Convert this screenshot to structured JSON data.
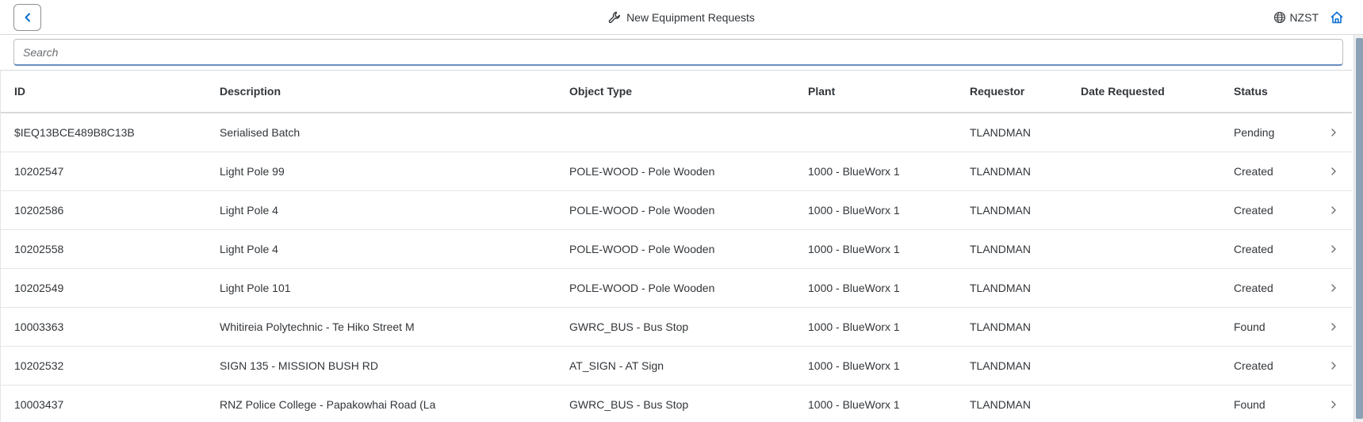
{
  "header": {
    "title": "New Equipment Requests",
    "timezone": "NZST",
    "accent_color": "#0a6ed1"
  },
  "search": {
    "placeholder": "Search",
    "value": ""
  },
  "table": {
    "columns": [
      "ID",
      "Description",
      "Object Type",
      "Plant",
      "Requestor",
      "Date Requested",
      "Status"
    ],
    "rows": [
      {
        "id": "$IEQ13BCE489B8C13B",
        "description": "Serialised Batch",
        "object_type": "",
        "plant": "",
        "requestor": "TLANDMAN",
        "date_requested": "",
        "status": "Pending"
      },
      {
        "id": "10202547",
        "description": "Light Pole 99",
        "object_type": "POLE-WOOD - Pole Wooden",
        "plant": "1000 - BlueWorx 1",
        "requestor": "TLANDMAN",
        "date_requested": "",
        "status": "Created"
      },
      {
        "id": "10202586",
        "description": "Light Pole 4",
        "object_type": "POLE-WOOD - Pole Wooden",
        "plant": "1000 - BlueWorx 1",
        "requestor": "TLANDMAN",
        "date_requested": "",
        "status": "Created"
      },
      {
        "id": "10202558",
        "description": "Light Pole 4",
        "object_type": "POLE-WOOD - Pole Wooden",
        "plant": "1000 - BlueWorx 1",
        "requestor": "TLANDMAN",
        "date_requested": "",
        "status": "Created"
      },
      {
        "id": "10202549",
        "description": "Light Pole 101",
        "object_type": "POLE-WOOD - Pole Wooden",
        "plant": "1000 - BlueWorx 1",
        "requestor": "TLANDMAN",
        "date_requested": "",
        "status": "Created"
      },
      {
        "id": "10003363",
        "description": "Whitireia Polytechnic - Te Hiko Street M",
        "object_type": "GWRC_BUS - Bus Stop",
        "plant": "1000 - BlueWorx 1",
        "requestor": "TLANDMAN",
        "date_requested": "",
        "status": "Found"
      },
      {
        "id": "10202532",
        "description": "SIGN 135 - MISSION BUSH RD",
        "object_type": "AT_SIGN - AT Sign",
        "plant": "1000 - BlueWorx 1",
        "requestor": "TLANDMAN",
        "date_requested": "",
        "status": "Created"
      },
      {
        "id": "10003437",
        "description": "RNZ Police College - Papakowhai Road (La",
        "object_type": "GWRC_BUS - Bus Stop",
        "plant": "1000 - BlueWorx 1",
        "requestor": "TLANDMAN",
        "date_requested": "",
        "status": "Found"
      }
    ]
  },
  "icons": {
    "back": "chevron-left-icon",
    "title": "wrench-icon",
    "timezone": "globe-icon",
    "home": "home-icon",
    "row_nav": "chevron-right-icon"
  }
}
